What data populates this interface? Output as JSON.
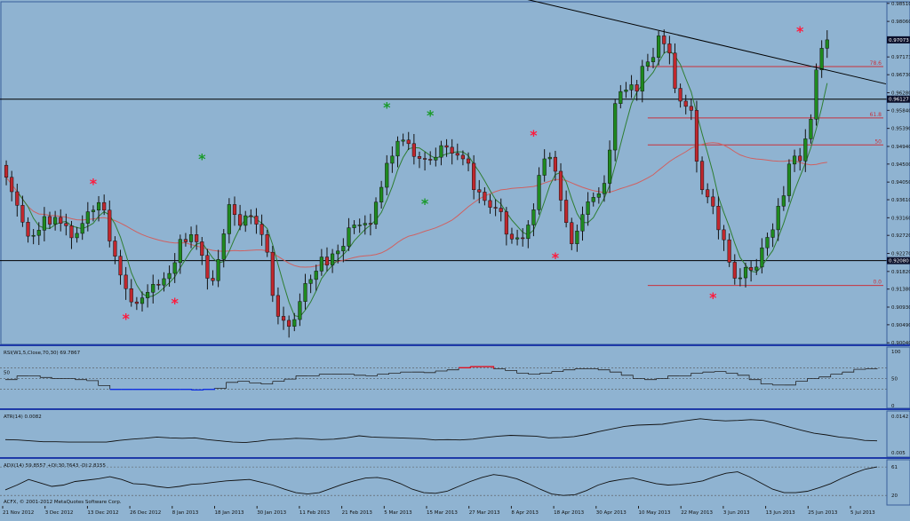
{
  "chart_data": {
    "type": "candlestick",
    "main_panel": {
      "ylim": [
        0.9,
        0.9855
      ],
      "y_ticks": [
        "0.98510",
        "0.98060",
        "0.97620",
        "0.97173",
        "0.96730",
        "0.96280",
        "0.95840",
        "0.95390",
        "0.94940",
        "0.94500",
        "0.94050",
        "0.93610",
        "0.93160",
        "0.92720",
        "0.92270",
        "0.91820",
        "0.91380",
        "0.90930",
        "0.90490",
        "0.90040"
      ],
      "current_price_label": "0.97073",
      "hlines": [
        {
          "value": 0.9612,
          "label": "0.96127",
          "color": "#000000"
        },
        {
          "value": 0.9209,
          "label": "0.92080",
          "color": "#000000"
        }
      ],
      "fib_levels": [
        {
          "label": "78.6",
          "value": 0.96932
        },
        {
          "label": "61.8",
          "value": 0.95651
        },
        {
          "label": "50",
          "value": 0.94978
        },
        {
          "label": "0.0",
          "value": 0.9147
        }
      ],
      "trendline": {
        "from": [
          0,
          0.9865
        ],
        "to": [
          1,
          0.965
        ]
      },
      "candle_count": 162,
      "candles": [
        0.9417,
        0.9381,
        0.9347,
        0.9305,
        0.927,
        0.9272,
        0.9285,
        0.9319,
        0.93,
        0.9317,
        0.9302,
        0.9296,
        0.9266,
        0.9277,
        0.9302,
        0.9331,
        0.9335,
        0.9354,
        0.9335,
        0.9258,
        0.922,
        0.9173,
        0.9139,
        0.9106,
        0.9102,
        0.9116,
        0.913,
        0.915,
        0.9148,
        0.9164,
        0.9177,
        0.9204,
        0.9262,
        0.9256,
        0.9274,
        0.9256,
        0.9222,
        0.9165,
        0.9159,
        0.9212,
        0.9276,
        0.9349,
        0.9324,
        0.9297,
        0.9321,
        0.932,
        0.93,
        0.9274,
        0.923,
        0.9122,
        0.907,
        0.906,
        0.9045,
        0.9062,
        0.9107,
        0.9152,
        0.9162,
        0.9183,
        0.9218,
        0.9198,
        0.9226,
        0.9233,
        0.9245,
        0.9291,
        0.9298,
        0.9298,
        0.9302,
        0.93,
        0.9355,
        0.9392,
        0.9452,
        0.947,
        0.9507,
        0.951,
        0.9501,
        0.9469,
        0.9464,
        0.9462,
        0.946,
        0.9467,
        0.9496,
        0.9492,
        0.9477,
        0.9472,
        0.9463,
        0.9452,
        0.9386,
        0.938,
        0.9359,
        0.9342,
        0.934,
        0.9331,
        0.9275,
        0.9263,
        0.9266,
        0.9264,
        0.9298,
        0.9336,
        0.9422,
        0.9463,
        0.9467,
        0.9432,
        0.936,
        0.9304,
        0.9251,
        0.9283,
        0.9324,
        0.9356,
        0.9367,
        0.9376,
        0.9402,
        0.9485,
        0.9601,
        0.9631,
        0.9635,
        0.9648,
        0.9632,
        0.9694,
        0.9705,
        0.9716,
        0.977,
        0.975,
        0.9727,
        0.9639,
        0.9607,
        0.9594,
        0.9584,
        0.9457,
        0.9386,
        0.9368,
        0.9345,
        0.9286,
        0.9261,
        0.9205,
        0.9165,
        0.9166,
        0.9192,
        0.9185,
        0.9193,
        0.9241,
        0.9267,
        0.9286,
        0.9345,
        0.9371,
        0.945,
        0.947,
        0.9458,
        0.9513,
        0.9562,
        0.9685,
        0.9739,
        0.976
      ],
      "markers": [
        {
          "i": 16,
          "value": 0.94,
          "color": "red"
        },
        {
          "i": 22,
          "value": 0.9063,
          "color": "red"
        },
        {
          "i": 31,
          "value": 0.9102,
          "color": "red"
        },
        {
          "i": 36,
          "value": 0.9462,
          "color": "green"
        },
        {
          "i": 70,
          "value": 0.959,
          "color": "green"
        },
        {
          "i": 77,
          "value": 0.935,
          "color": "green"
        },
        {
          "i": 78,
          "value": 0.957,
          "color": "green"
        },
        {
          "i": 97,
          "value": 0.952,
          "color": "red"
        },
        {
          "i": 101,
          "value": 0.9215,
          "color": "red"
        },
        {
          "i": 130,
          "value": 0.9115,
          "color": "red"
        },
        {
          "i": 146,
          "value": 0.978,
          "color": "red"
        }
      ]
    },
    "rsi_panel": {
      "label": "RSI(W1,5,Close,70,30) 69.7867",
      "ylim": [
        0,
        100
      ],
      "levels": [
        70,
        30
      ],
      "tick_labels": [
        "100",
        "50",
        "0"
      ],
      "left_marker": "50",
      "values": [
        48,
        55,
        55,
        52,
        50,
        50,
        48,
        46,
        37,
        30,
        30,
        30,
        30,
        30,
        30,
        30,
        29,
        30,
        32,
        43,
        45,
        42,
        40,
        45,
        49,
        55,
        55,
        58,
        58,
        58,
        56,
        55,
        58,
        60,
        62,
        62,
        61,
        64,
        66,
        70,
        72,
        72,
        68,
        65,
        60,
        58,
        60,
        63,
        66,
        68,
        68,
        66,
        62,
        56,
        50,
        48,
        50,
        55,
        55,
        60,
        62,
        63,
        60,
        56,
        48,
        40,
        38,
        38,
        45,
        50,
        53,
        58,
        62,
        67,
        68,
        69
      ],
      "overbought_color": "red",
      "oversold_color": "blue"
    },
    "atr_panel": {
      "label": "ATR(14) 0.0082",
      "tick_top": "0.0142",
      "tick_bottom": "0.005",
      "ylim": [
        0.005,
        0.0142
      ],
      "values": [
        0.0085,
        0.0084,
        0.0082,
        0.008,
        0.008,
        0.0079,
        0.0079,
        0.0079,
        0.0079,
        0.0083,
        0.0086,
        0.0088,
        0.0091,
        0.0089,
        0.0088,
        0.0089,
        0.0085,
        0.0082,
        0.0079,
        0.0078,
        0.0081,
        0.0085,
        0.0086,
        0.0088,
        0.0087,
        0.0085,
        0.0086,
        0.0089,
        0.0094,
        0.0091,
        0.009,
        0.0089,
        0.0088,
        0.0087,
        0.0084,
        0.0085,
        0.0084,
        0.0086,
        0.009,
        0.0093,
        0.0095,
        0.0094,
        0.0093,
        0.0089,
        0.009,
        0.0092,
        0.0097,
        0.0104,
        0.011,
        0.0116,
        0.0119,
        0.012,
        0.0121,
        0.0126,
        0.013,
        0.0134,
        0.0131,
        0.0129,
        0.013,
        0.0132,
        0.013,
        0.0123,
        0.0115,
        0.0107,
        0.01,
        0.0096,
        0.0091,
        0.0088,
        0.0083,
        0.0082
      ]
    },
    "adx_panel": {
      "label": "ADX(14) 59.8557 +DI:30.7643 -DI:2.8155",
      "tick_top": "61",
      "tick_mid": "20",
      "levels": [
        20,
        61
      ],
      "ylim": [
        10,
        65
      ],
      "values": [
        28,
        35,
        43,
        38,
        33,
        35,
        40,
        42,
        44,
        47,
        43,
        37,
        36,
        33,
        31,
        33,
        36,
        37,
        39,
        41,
        42,
        43,
        39,
        35,
        29,
        24,
        22,
        24,
        30,
        36,
        41,
        45,
        46,
        43,
        37,
        29,
        24,
        23,
        26,
        33,
        40,
        46,
        50,
        48,
        44,
        37,
        29,
        22,
        20,
        21,
        27,
        35,
        40,
        43,
        45,
        41,
        37,
        35,
        36,
        38,
        41,
        47,
        52,
        54,
        47,
        38,
        29,
        24,
        24,
        26,
        31,
        37,
        45,
        52,
        58,
        61
      ]
    },
    "x_labels": [
      "21 Nov 2012",
      "3 Dec 2012",
      "13 Dec 2012",
      "26 Dec 2012",
      "8 Jan 2013",
      "18 Jan 2013",
      "30 Jan 2013",
      "11 Feb 2013",
      "21 Feb 2013",
      "5 Mar 2013",
      "15 Mar 2013",
      "27 Mar 2013",
      "8 Apr 2013",
      "18 Apr 2013",
      "30 Apr 2013",
      "10 May 2013",
      "22 May 2013",
      "3 Jun 2013",
      "13 Jun 2013",
      "25 Jun 2013",
      "5 Jul 2013"
    ],
    "copyright": "ACFX, © 2001-2012 MetaQuotes Software Corp.",
    "colors": {
      "background": "#8fb3d1",
      "up_candle": "#1f8a1f",
      "down_candle": "#c0272d",
      "fast_ma": "#2e7d32",
      "slow_ma": "#d06060",
      "fib": "#c8323c",
      "separator": "#1e3aa8"
    }
  }
}
